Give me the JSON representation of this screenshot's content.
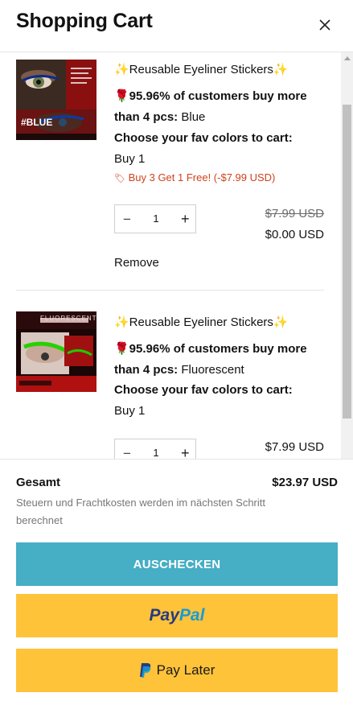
{
  "header": {
    "title": "Shopping Cart"
  },
  "items": [
    {
      "title": "✨Reusable Eyeliner Stickers✨",
      "prop1_label": "🌹95.96% of customers buy more than 4 pcs:",
      "prop1_value": "Blue",
      "prop2_label": "Choose your fav colors to cart:",
      "prop2_value": "Buy 1",
      "discount": "Buy 3 Get 1 Free! (-$7.99 USD)",
      "quantity": "1",
      "price_old": "$7.99 USD",
      "price": "$0.00 USD",
      "remove": "Remove",
      "thumb_label": "#BLUE"
    },
    {
      "title": "✨Reusable Eyeliner Stickers✨",
      "prop1_label": "🌹95.96% of customers buy more than 4 pcs:",
      "prop1_value": "Fluorescent",
      "prop2_label": "Choose your fav colors to cart:",
      "prop2_value": "Buy 1",
      "quantity": "1",
      "price": "$7.99 USD",
      "thumb_label": "FLUORESCENT"
    }
  ],
  "footer": {
    "total_label": "Gesamt",
    "total_value": "$23.97 USD",
    "tax_note": "Steuern und Frachtkosten werden im nächsten Schritt berechnet",
    "checkout_label": "AUSCHECKEN",
    "paypal_pay": "Pay",
    "paypal_pal": "Pal",
    "paylater_label": "Pay Later"
  },
  "colors": {
    "checkout": "#46aec5",
    "paypal": "#ffc33a",
    "discount": "#d0421b"
  }
}
